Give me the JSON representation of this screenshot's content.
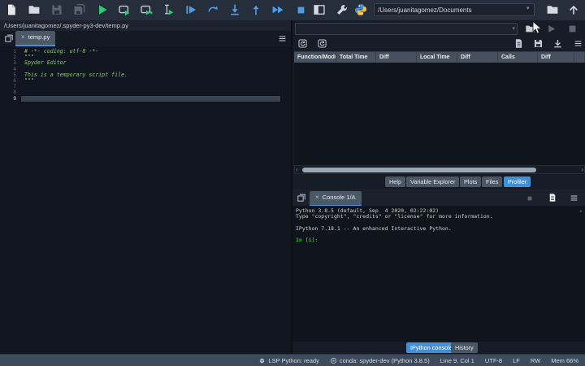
{
  "toolbar": {
    "path_value": "/Users/juanitagomez/Documents"
  },
  "glyphs": {
    "close": "×",
    "dropdown": "▾",
    "scroll_left": "‹",
    "scroll_right": "›",
    "scroll_up": "▴"
  },
  "editor": {
    "breadcrumb": "/Users/juanitagomez/.spyder-py3-dev/temp.py",
    "tab_label": "temp.py",
    "lines": [
      {
        "n": "1",
        "text": "# -*- coding: utf-8 -*-"
      },
      {
        "n": "2",
        "text": "\"\"\""
      },
      {
        "n": "3",
        "text": "Spyder Editor"
      },
      {
        "n": "4",
        "text": ""
      },
      {
        "n": "5",
        "text": "This is a temporary script file."
      },
      {
        "n": "6",
        "text": "\"\"\""
      },
      {
        "n": "7",
        "text": ""
      },
      {
        "n": "8",
        "text": ""
      },
      {
        "n": "9",
        "text": ""
      }
    ],
    "current_line": 9
  },
  "profiler": {
    "columns": [
      "Function/Modu",
      "Total Time",
      "Diff",
      "Local Time",
      "Diff",
      "Calls",
      "Diff"
    ],
    "rows": []
  },
  "pane_tabs": {
    "help": "Help",
    "variable_explorer": "Variable Explorer",
    "plots": "Plots",
    "files": "Files",
    "profiler": "Profiler",
    "active": "Profiler"
  },
  "console": {
    "tab_label": "Console 1/A",
    "banner": [
      "Python 3.8.5 (default, Sep  4 2020, 02:22:02)",
      "Type \"copyright\", \"credits\" or \"license\" for more information.",
      "",
      "IPython 7.18.1 -- An enhanced Interactive Python.",
      ""
    ],
    "prompt": "In [1]:"
  },
  "console_tabs": {
    "ipython": "IPython console",
    "history": "History",
    "active": "IPython console"
  },
  "statusbar": {
    "lsp": "LSP Python: ready",
    "interpreter": "conda: spyder-dev (Python 3.8.5)",
    "cursor_position": "Line 9, Col 1",
    "encoding": "UTF-8",
    "eol": "LF",
    "permissions": "RW",
    "memory": "Mem 66%"
  },
  "colors": {
    "accent_blue": "#3f8fd9",
    "run_green": "#2ecc71",
    "debug_blue": "#4f9ce8",
    "code_green": "#8cc37a",
    "prompt_green": "#2db52d",
    "statusbar_bg": "#3e4a5d",
    "toolbar_bg": "#262d3b",
    "editor_bg": "#10161f"
  }
}
